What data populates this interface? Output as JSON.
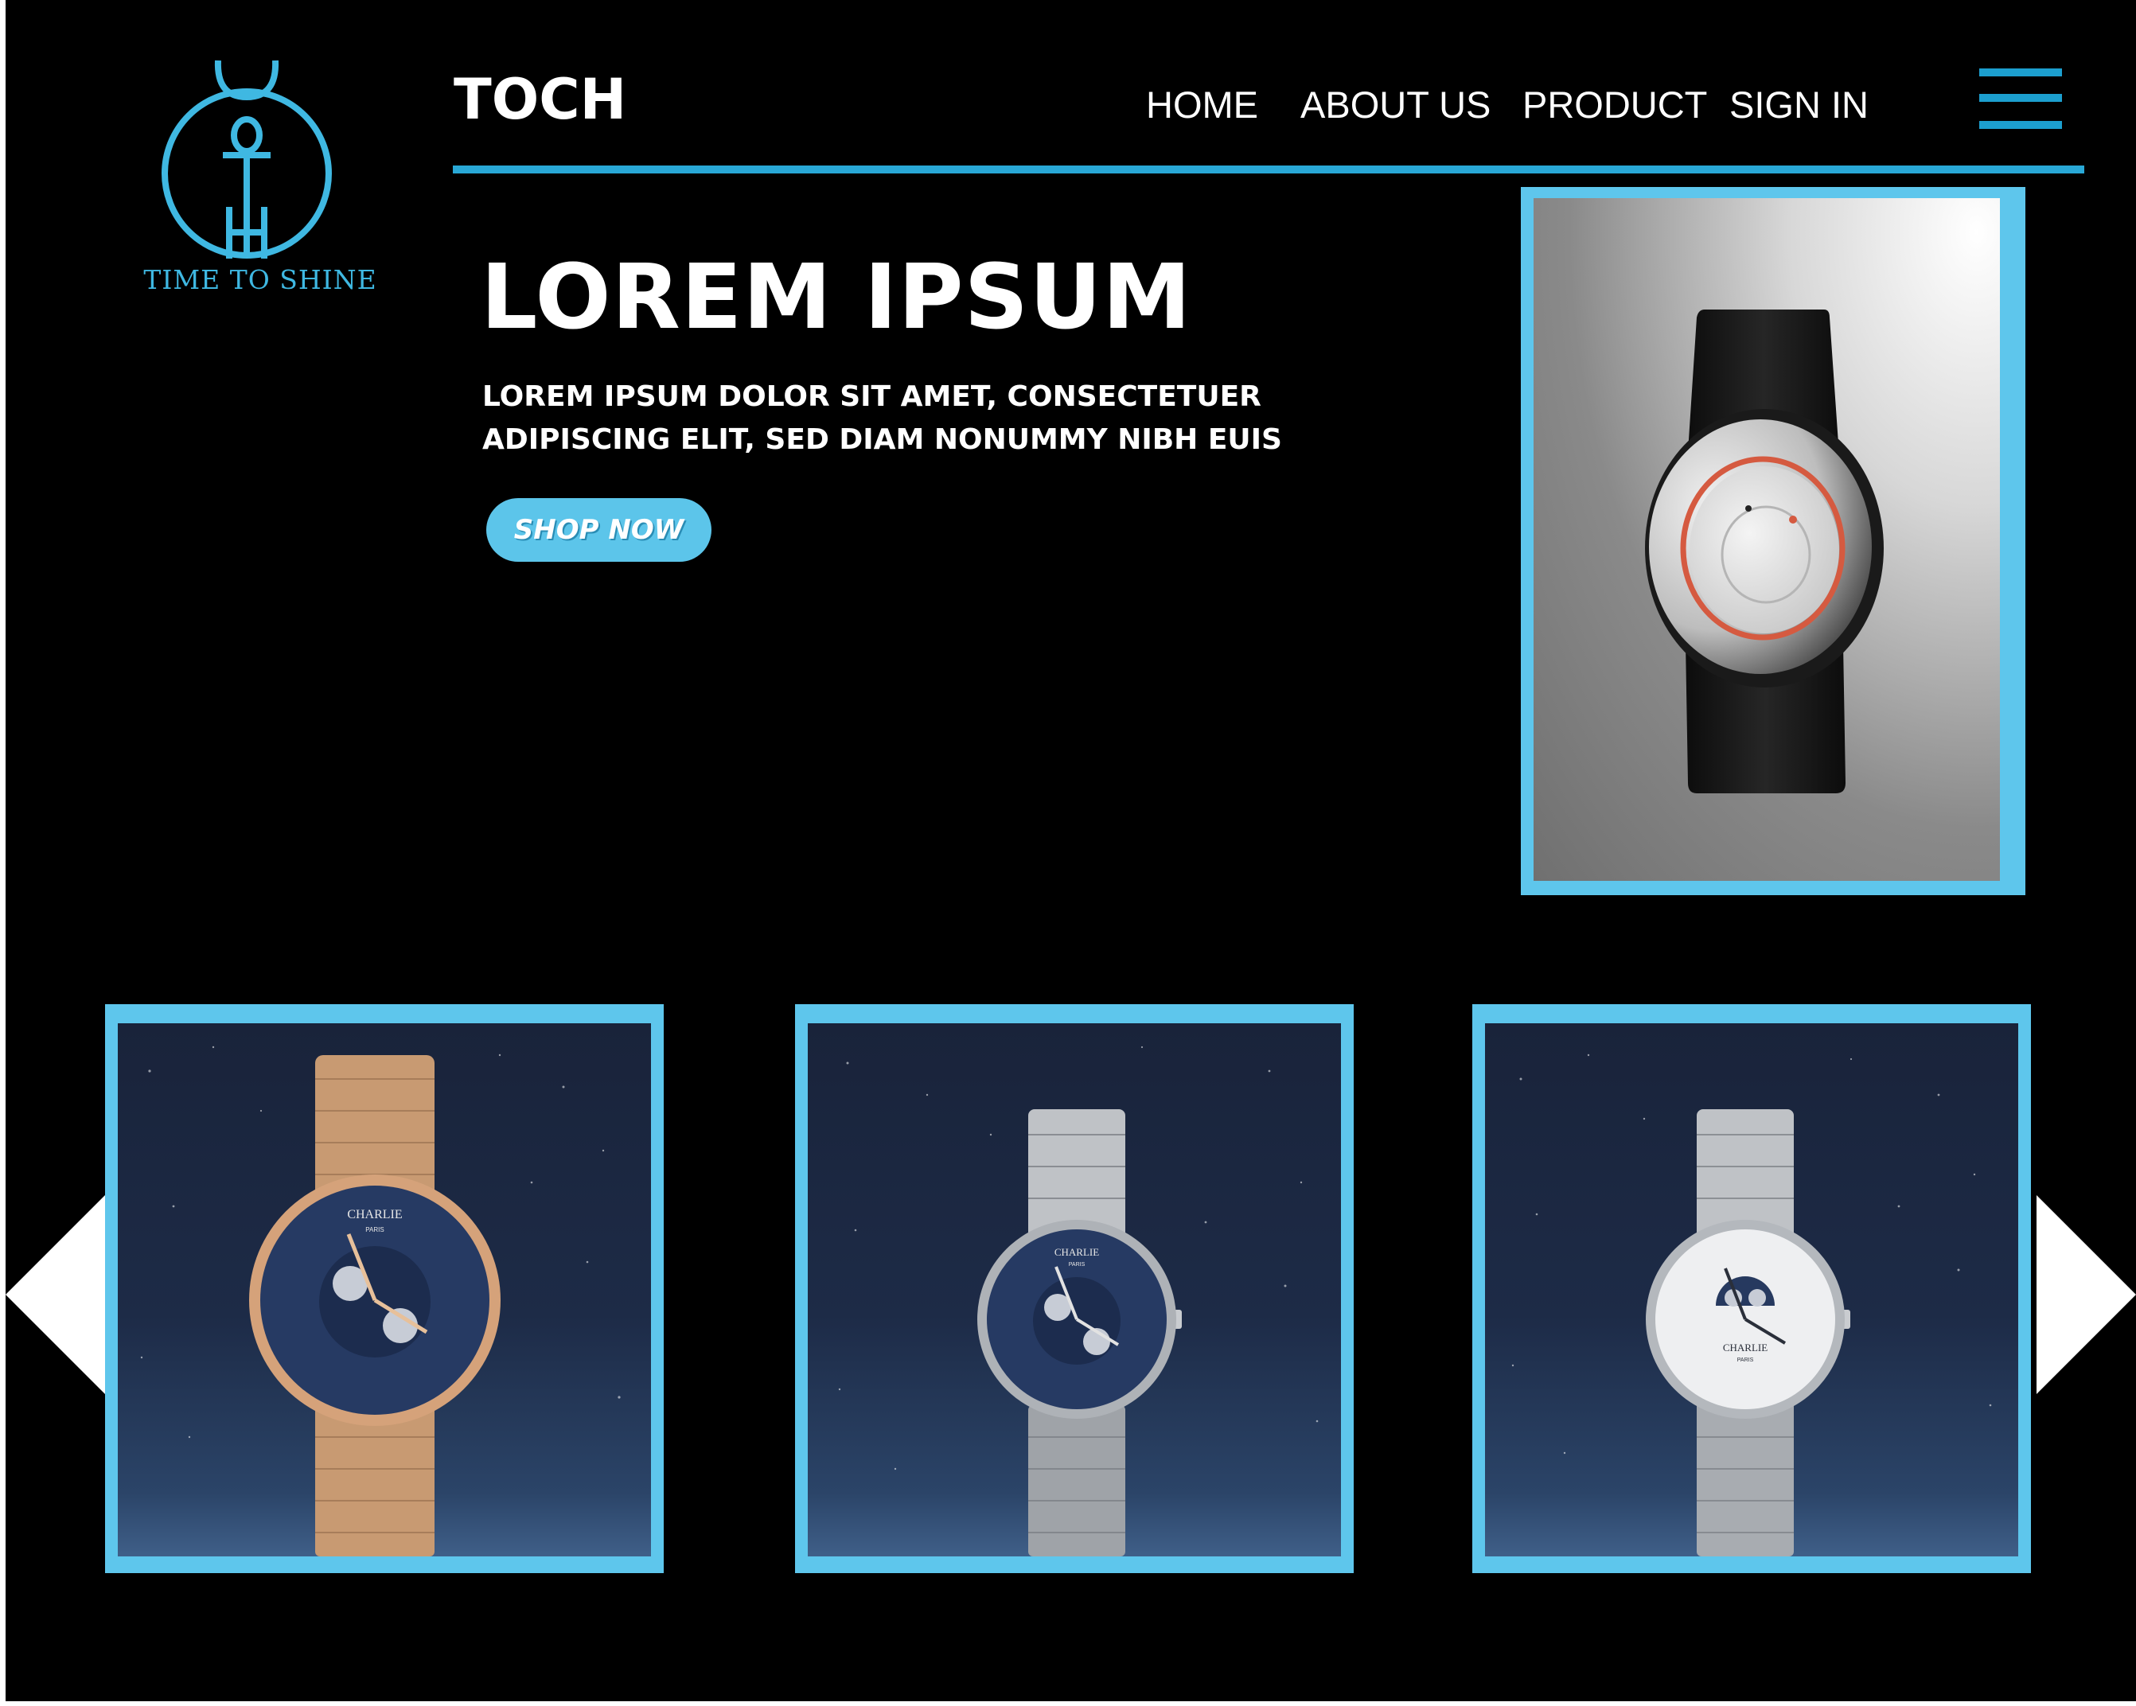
{
  "logo": {
    "caption": "TIME TO SHINE",
    "icon": "clock-ankh-logo"
  },
  "header": {
    "brand": "TOCH",
    "nav": [
      "HOME",
      "ABOUT US",
      "PRODUCT",
      "SIGN IN"
    ],
    "menu_icon": "hamburger-menu-icon"
  },
  "hero": {
    "title": "LOREM IPSUM",
    "description": "LOREM IPSUM DOLOR SIT AMET, CONSECTETUER ADIPISCING ELIT, SED DIAM NONUMMY NIBH EUIS",
    "cta_label": "SHOP NOW",
    "image": "black-smartwatch-photo"
  },
  "products": [
    {
      "brand_mark": "CHARLIE",
      "sub_mark": "PARIS",
      "finish": "rose-gold",
      "dial": "blue"
    },
    {
      "brand_mark": "CHARLIE",
      "sub_mark": "PARIS",
      "finish": "silver",
      "dial": "blue"
    },
    {
      "brand_mark": "CHARLIE",
      "sub_mark": "PARIS",
      "finish": "silver",
      "dial": "white"
    }
  ],
  "carousel": {
    "prev_icon": "arrow-left-icon",
    "next_icon": "arrow-right-icon"
  },
  "colors": {
    "accent": "#5ec6ec",
    "nav_line": "#29a8d6",
    "background": "#000000",
    "logo": "#3fb8e2"
  }
}
